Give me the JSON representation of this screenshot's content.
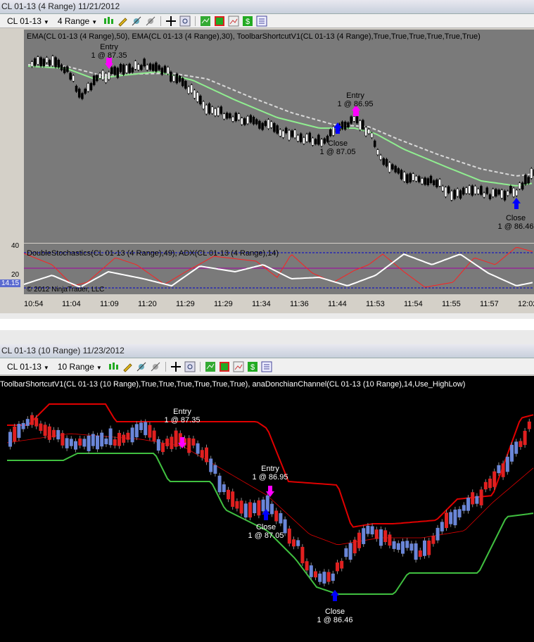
{
  "top_window": {
    "title": "CL 01-13 (4 Range)  11/21/2012",
    "instrument": "CL 01-13",
    "period": "4 Range",
    "indicators_label": "EMA(CL 01-13 (4 Range),50), EMA(CL 01-13 (4 Range),30), ToolbarShortcutV1(CL 01-13 (4 Range),True,True,True,True,True,True)",
    "osc_label": "DoubleStochastics(CL 01-13 (4 Range),49), ADX(CL 01-13 (4 Range),14)",
    "copyright": "© 2012 NinjaTrader, LLC",
    "osc_axis": [
      "40",
      "20"
    ],
    "price_marker": "14.15",
    "time_labels": [
      "10:54",
      "11:04",
      "11:09",
      "11:20",
      "11:29",
      "11:29",
      "11:34",
      "11:36",
      "11:44",
      "11:53",
      "11:54",
      "11:55",
      "11:57",
      "12:02"
    ],
    "annotations": [
      {
        "line1": "Entry",
        "line2": "1 @ 87.35"
      },
      {
        "line1": "Entry",
        "line2": "1 @ 86.95"
      },
      {
        "line1": "Close",
        "line2": "1 @ 87.05"
      },
      {
        "line1": "Close",
        "line2": "1 @ 86.46"
      }
    ],
    "colors": {
      "bg": "#7a7a7a",
      "ema_fast": "#90ee90",
      "ema_slow": "#d8d8d8",
      "stoch": "#ffffff",
      "adx": "#ff2020",
      "band": "#0000cc",
      "mid": "#a000a0"
    }
  },
  "bottom_window": {
    "title": "CL 01-13 (10 Range)  11/23/2012",
    "instrument": "CL 01-13",
    "period": "10 Range",
    "indicators_label": "ToolbarShortcutV1(CL 01-13 (10 Range),True,True,True,True,True,True), anaDonchianChannel(CL 01-13 (10 Range),14,Use_HighLow)",
    "annotations": [
      {
        "line1": "Entry",
        "line2": "1 @ 87.35"
      },
      {
        "line1": "Entry",
        "line2": "1 @ 86.95"
      },
      {
        "line1": "Close",
        "line2": "1 @ 87.05"
      },
      {
        "line1": "Close",
        "line2": "1 @ 86.46"
      }
    ],
    "colors": {
      "bg": "#000000",
      "up": "#6a86d8",
      "down": "#e02020",
      "donchian_up": "#40c040",
      "donchian_down": "#e00000",
      "donchian_flat": "#f4a080"
    }
  }
}
